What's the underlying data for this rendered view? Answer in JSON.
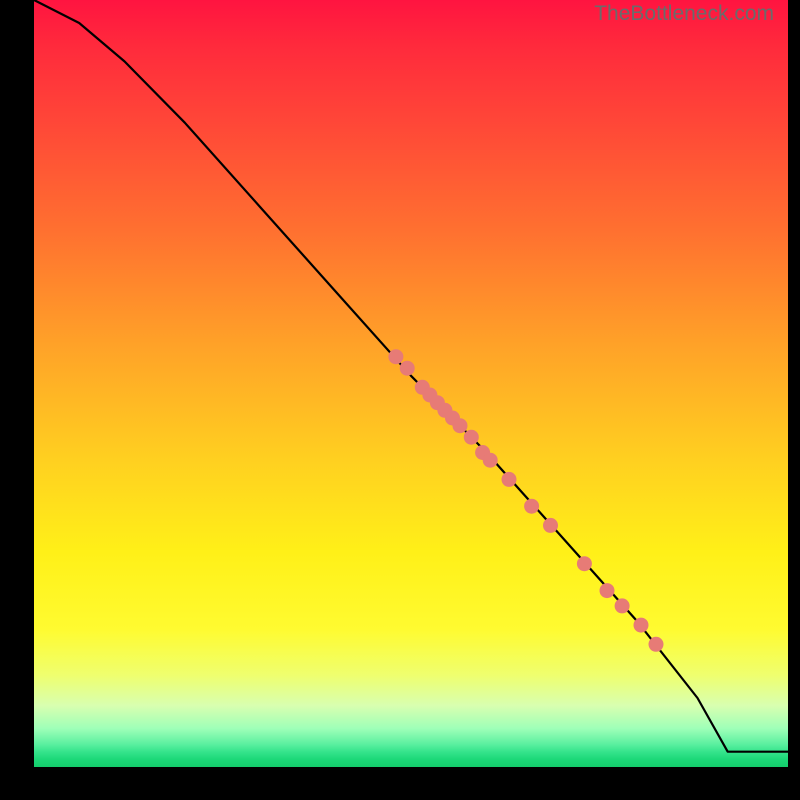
{
  "watermark": "TheBottleneck.com",
  "chart_data": {
    "type": "line",
    "title": "",
    "xlabel": "",
    "ylabel": "",
    "xlim": [
      0,
      100
    ],
    "ylim": [
      0,
      100
    ],
    "grid": false,
    "legend": false,
    "series": [
      {
        "name": "curve",
        "x": [
          0,
          6,
          12,
          20,
          30,
          40,
          50,
          60,
          70,
          80,
          88,
          92,
          100
        ],
        "y": [
          100,
          97,
          92,
          84,
          73,
          62,
          51,
          41,
          30,
          19,
          9,
          2,
          2
        ]
      }
    ],
    "markers": {
      "name": "dots",
      "x": [
        48.0,
        49.5,
        51.5,
        52.5,
        53.5,
        54.5,
        55.5,
        56.5,
        58.0,
        59.5,
        60.5,
        63.0,
        66.0,
        68.5,
        73.0,
        76.0,
        78.0,
        80.5,
        82.5
      ],
      "y": [
        53.5,
        52.0,
        49.5,
        48.5,
        47.5,
        46.5,
        45.5,
        44.5,
        43.0,
        41.0,
        40.0,
        37.5,
        34.0,
        31.5,
        26.5,
        23.0,
        21.0,
        18.5,
        16.0
      ]
    },
    "colors": {
      "curve": "#000000",
      "markers": "#e77b76"
    }
  }
}
